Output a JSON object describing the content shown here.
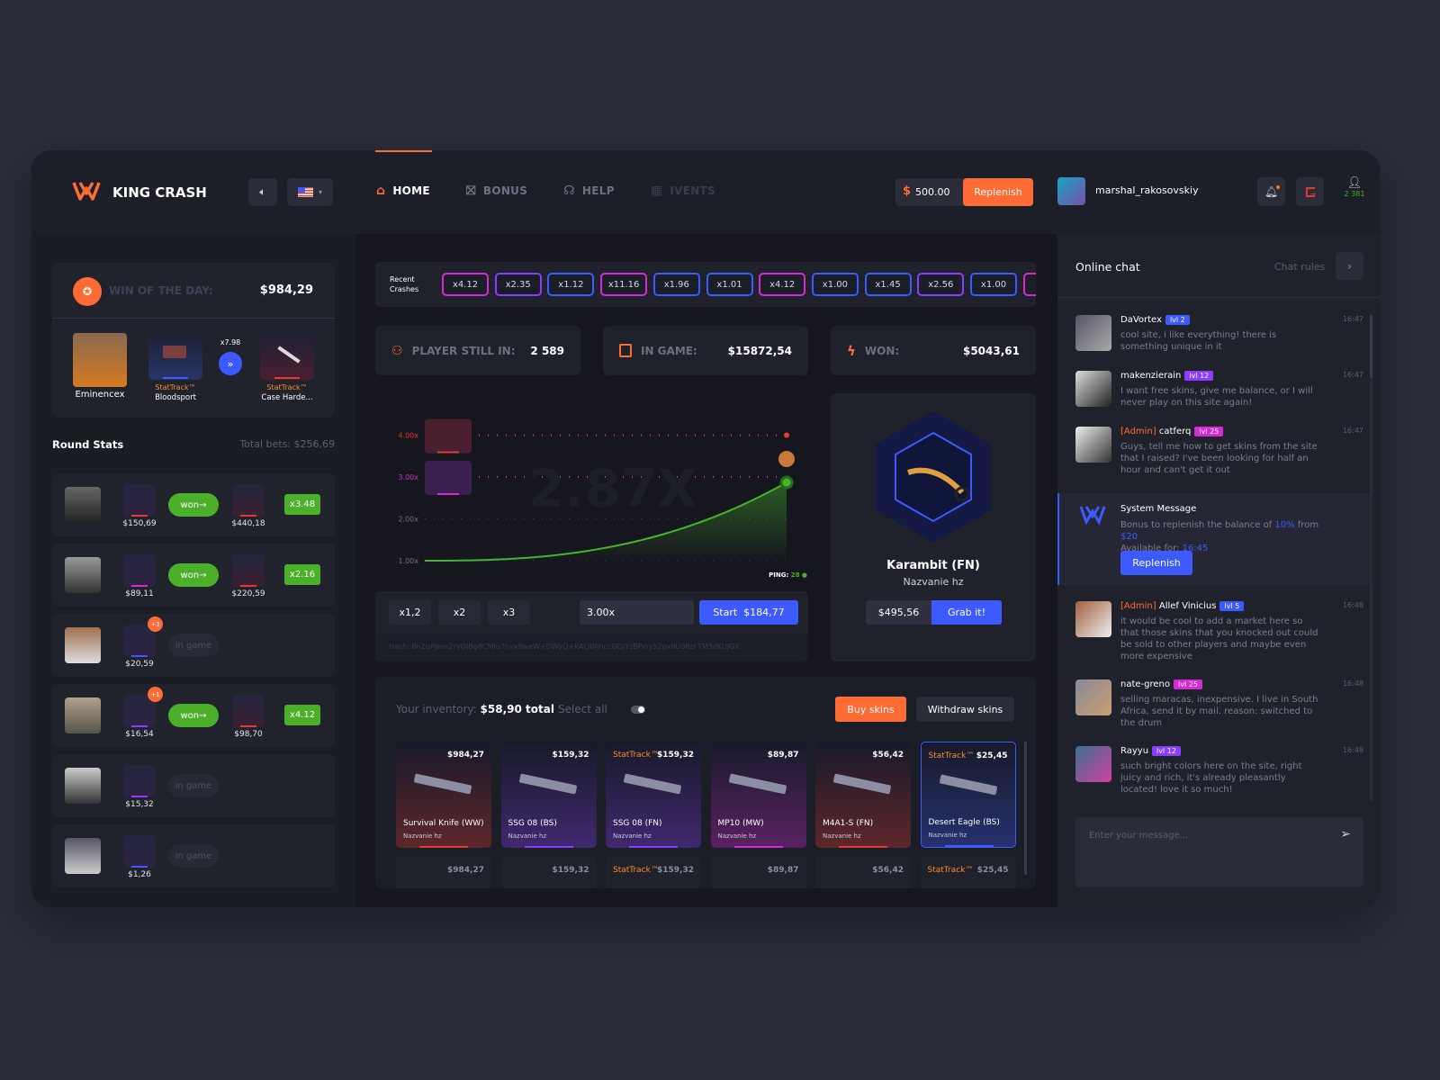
{
  "header": {
    "brand": "KING CRASH",
    "nav": [
      {
        "label": "HOME",
        "icon": "home-icon",
        "active": true
      },
      {
        "label": "BONUS",
        "icon": "gift-icon",
        "active": false
      },
      {
        "label": "HELP",
        "icon": "headset-icon",
        "active": false
      },
      {
        "label": "IVENTS",
        "icon": "calendar-icon",
        "active": false
      }
    ],
    "balance": "500.00",
    "currency_symbol": "$",
    "replenish_label": "Replenish",
    "username": "marshal_rakosovskiy",
    "online_count": "2 381",
    "accent": "#ff6b35"
  },
  "win_of_day": {
    "label": "WIN OF THE DAY:",
    "amount": "$984,29",
    "player": "Eminencex",
    "from_tag": "StatTrack™",
    "from_item": "Bloodsport",
    "multiplier": "x7.98",
    "to_tag": "StatTrack™",
    "to_item": "Case Harde..."
  },
  "round_stats": {
    "title": "Round Stats",
    "total_bets": "Total bets: $256,69",
    "rows": [
      {
        "bet": "$150,69",
        "status": "won",
        "win": "$440,18",
        "mult": "x3.48",
        "plus": "",
        "bet_color": "#e53935",
        "win_color": "#e53935"
      },
      {
        "bet": "$89,11",
        "status": "won",
        "win": "$220,59",
        "mult": "x2.16",
        "plus": "",
        "bet_color": "#d62ad6",
        "win_color": "#e53935"
      },
      {
        "bet": "$20,59",
        "status": "in game",
        "win": "",
        "mult": "",
        "plus": "+3",
        "bet_color": "#3d5afe",
        "win_color": ""
      },
      {
        "bet": "$16,54",
        "status": "won",
        "win": "$98,70",
        "mult": "x4.12",
        "plus": "+1",
        "bet_color": "#8a3dfe",
        "win_color": "#e53935"
      },
      {
        "bet": "$15,32",
        "status": "in game",
        "win": "",
        "mult": "",
        "plus": "",
        "bet_color": "#8a3dfe",
        "win_color": ""
      },
      {
        "bet": "$1,26",
        "status": "in game",
        "win": "",
        "mult": "",
        "plus": "",
        "bet_color": "#3d5afe",
        "win_color": ""
      }
    ]
  },
  "recent_crashes": {
    "label": "Recent Crashes",
    "items": [
      {
        "v": "x4.12",
        "c": "#d62ad6"
      },
      {
        "v": "x2.35",
        "c": "#8a3dfe"
      },
      {
        "v": "x1.12",
        "c": "#3d5afe"
      },
      {
        "v": "x11.16",
        "c": "#d62ad6"
      },
      {
        "v": "x1.96",
        "c": "#3d5afe"
      },
      {
        "v": "x1.01",
        "c": "#3d5afe"
      },
      {
        "v": "x4.12",
        "c": "#d62ad6"
      },
      {
        "v": "x1.00",
        "c": "#3d5afe"
      },
      {
        "v": "x1.45",
        "c": "#3d5afe"
      },
      {
        "v": "x2.56",
        "c": "#8a3dfe"
      },
      {
        "v": "x1.00",
        "c": "#3d5afe"
      },
      {
        "v": "",
        "c": "#d62ad6"
      }
    ]
  },
  "stats": {
    "players_label": "PLAYER STILL IN:",
    "players": "2 589",
    "ingame_label": "IN GAME:",
    "ingame": "$15872,54",
    "won_label": "WON:",
    "won": "$5043,61"
  },
  "game": {
    "current_multiplier": "2.87X",
    "current_value": 2.87,
    "y_ticks": [
      "1.00x",
      "2.00x",
      "3.00x",
      "4.00x"
    ],
    "y_range": [
      1,
      4
    ],
    "ping_label": "PING:",
    "ping": "28",
    "quick": [
      "x1,2",
      "x2",
      "x3"
    ],
    "auto_cashout": "3.00x",
    "start_label": "Start  $184,77",
    "hash": "Hash: 8hZqPJem2rVOJBg8CMlu7hyx9weW+DWyQ+kALJ0fjhccGOJYzBPiny52gx9U98zFTM3dKUJGX"
  },
  "prize": {
    "name": "Karambit (FN)",
    "sub": "Nazvanie hz",
    "value": "$495,56",
    "grab_label": "Grab it!"
  },
  "inventory": {
    "label": "Your inventory:",
    "total": "$58,90 total",
    "select_all": "Select all",
    "buy_label": "Buy skins",
    "withdraw_label": "Withdraw skins",
    "items": [
      {
        "price": "$984,27",
        "tag": "",
        "name": "Survival Knife (WW)",
        "sub": "Nazvanie hz",
        "color": "#e53935"
      },
      {
        "price": "$159,32",
        "tag": "",
        "name": "SSG 08 (BS)",
        "sub": "Nazvanie hz",
        "color": "#8a3dfe"
      },
      {
        "price": "$159,32",
        "tag": "StatTrack™",
        "name": "SSG 08 (FN)",
        "sub": "Nazvanie hz",
        "color": "#8a3dfe"
      },
      {
        "price": "$89,87",
        "tag": "",
        "name": "MP10 (MW)",
        "sub": "Nazvanie hz",
        "color": "#d62ad6"
      },
      {
        "price": "$56,42",
        "tag": "",
        "name": "M4A1-S (FN)",
        "sub": "Nazvanie hz",
        "color": "#e53935"
      },
      {
        "price": "$25,45",
        "tag": "StatTrack™",
        "name": "Desert Eagle (BS)",
        "sub": "Nazvanie hz",
        "color": "#3d5afe",
        "selected": true
      }
    ]
  },
  "chat": {
    "title": "Online chat",
    "rules": "Chat rules",
    "placeholder": "Enter your message...",
    "messages": [
      {
        "admin": "",
        "name": "DaVortex",
        "lvl": "lvl 2",
        "lvl_color": "#3d5afe",
        "time": "16:47",
        "text": "cool site, i like everything! there is something unique in it"
      },
      {
        "admin": "",
        "name": "makenzierain",
        "lvl": "lvl 12",
        "lvl_color": "#8a3dfe",
        "time": "16:47",
        "text": "I want free skins, give me balance, or I will never play on this site again!"
      },
      {
        "admin": "[Admin]",
        "name": "catferq",
        "lvl": "lvl 25",
        "lvl_color": "#d62ad6",
        "time": "16:47",
        "text": "Guys, tell me how to get skins from the site that I raised? I've been looking for half an hour and can't get it out"
      },
      {
        "admin": "[Admin]",
        "name": "Allef Vinicius",
        "lvl": "lvl 5",
        "lvl_color": "#3d5afe",
        "time": "16:48",
        "text": "it would be cool to add a market here so that those skins that you knocked out could be sold to other players and maybe even more expensive"
      },
      {
        "admin": "",
        "name": "nate-greno",
        "lvl": "lvl 25",
        "lvl_color": "#d62ad6",
        "time": "16:48",
        "text": "selling maracas, inexpensive. I live in South Africa, send it by mail. reason: switched to the drum"
      },
      {
        "admin": "",
        "name": "Rayyu",
        "lvl": "lvl 12",
        "lvl_color": "#8a3dfe",
        "time": "16:48",
        "text": "such bright colors here on the site, right juicy and rich, it's already pleasantly located! love it so much!"
      }
    ],
    "system": {
      "title": "System Message",
      "pre": "Bonus to replenish the balance of ",
      "pct": "10%",
      "mid": " from ",
      "amt": "$20",
      "avail": "Available for: ",
      "time": "16:45",
      "button": "Replenish"
    }
  }
}
